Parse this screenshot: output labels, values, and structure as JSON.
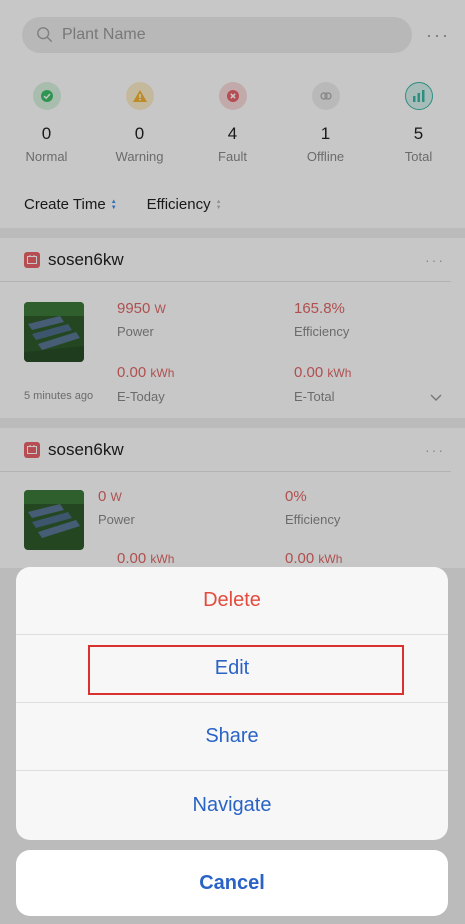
{
  "search": {
    "placeholder": "Plant Name"
  },
  "top_more_icon": "more-horizontal-icon",
  "stats": [
    {
      "count": "0",
      "label": "Normal",
      "icon": "check-circle-icon",
      "color": "#3fbf6a"
    },
    {
      "count": "0",
      "label": "Warning",
      "icon": "warning-icon",
      "color": "#f2b233"
    },
    {
      "count": "4",
      "label": "Fault",
      "icon": "fault-x-icon",
      "color": "#e8636b"
    },
    {
      "count": "1",
      "label": "Offline",
      "icon": "offline-link-icon",
      "color": "#b0b0b0"
    },
    {
      "count": "5",
      "label": "Total",
      "icon": "chart-total-icon",
      "color": "#3bb7a4"
    }
  ],
  "sort": {
    "create_time": "Create Time",
    "efficiency": "Efficiency"
  },
  "plants": [
    {
      "name": "sosen6kw",
      "power_value": "9950",
      "power_unit": "W",
      "power_label": "Power",
      "efficiency_value": "165.8%",
      "efficiency_label": "Efficiency",
      "e_today_value": "0.00",
      "e_today_unit": "kWh",
      "e_today_label": "E-Today",
      "e_total_value": "0.00",
      "e_total_unit": "kWh",
      "e_total_label": "E-Total",
      "updated": "5 minutes ago"
    },
    {
      "name": "sosen6kw",
      "power_value": "0",
      "power_unit": "W",
      "power_label": "Power",
      "efficiency_value": "0%",
      "efficiency_label": "Efficiency",
      "e_today_value": "0.00",
      "e_today_unit": "kWh",
      "e_total_value": "0.00",
      "e_total_unit": "kWh"
    }
  ],
  "action_sheet": {
    "delete": "Delete",
    "edit": "Edit",
    "share": "Share",
    "navigate": "Navigate",
    "cancel": "Cancel"
  },
  "colors": {
    "accent": "#2a63c6",
    "danger": "#e34b3e",
    "value": "#e06767",
    "highlight": "#d93030"
  }
}
